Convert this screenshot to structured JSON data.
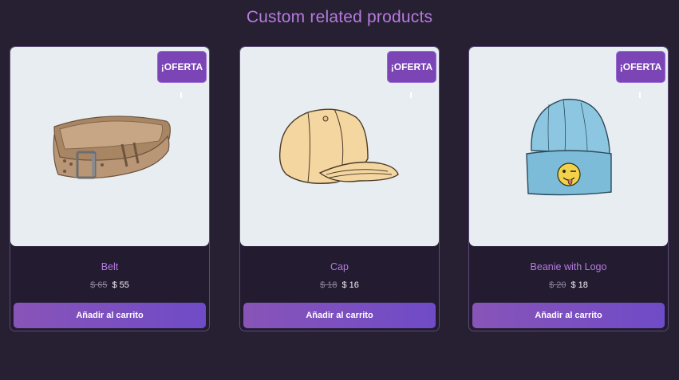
{
  "section": {
    "title": "Custom related products"
  },
  "products": [
    {
      "name": "Belt",
      "badge": "¡OFERTA",
      "old_price": "$ 65",
      "price": "$ 55",
      "button": "Añadir al carrito",
      "image": "belt"
    },
    {
      "name": "Cap",
      "badge": "¡OFERTA",
      "old_price": "$ 18",
      "price": "$ 16",
      "button": "Añadir al carrito",
      "image": "cap"
    },
    {
      "name": "Beanie with Logo",
      "badge": "¡OFERTA",
      "old_price": "$ 20",
      "price": "$ 18",
      "button": "Añadir al carrito",
      "image": "beanie"
    }
  ],
  "colors": {
    "background": "#272033",
    "accent": "#b57bdf",
    "badge": "#7b45b6",
    "button_start": "#8854b8",
    "button_end": "#6f4bc7"
  }
}
